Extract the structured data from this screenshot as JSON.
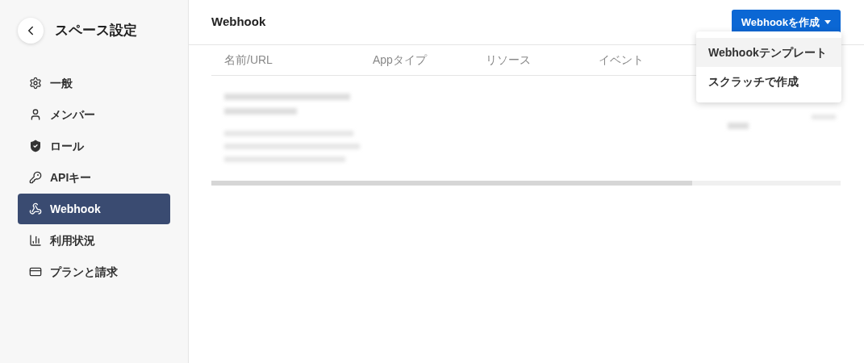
{
  "sidebar": {
    "title": "スペース設定",
    "items": [
      {
        "label": "一般",
        "selected": false
      },
      {
        "label": "メンバー",
        "selected": false
      },
      {
        "label": "ロール",
        "selected": false
      },
      {
        "label": "APIキー",
        "selected": false
      },
      {
        "label": "Webhook",
        "selected": true
      },
      {
        "label": "利用状況",
        "selected": false
      },
      {
        "label": "プランと請求",
        "selected": false
      }
    ]
  },
  "header": {
    "title": "Webhook",
    "create_button": "Webhookを作成"
  },
  "dropdown": {
    "items": [
      {
        "label": "Webhookテンプレート",
        "highlighted": true
      },
      {
        "label": "スクラッチで作成",
        "highlighted": false
      }
    ]
  },
  "table": {
    "columns": [
      "名前/URL",
      "Appタイプ",
      "リソース",
      "イベント"
    ]
  }
}
